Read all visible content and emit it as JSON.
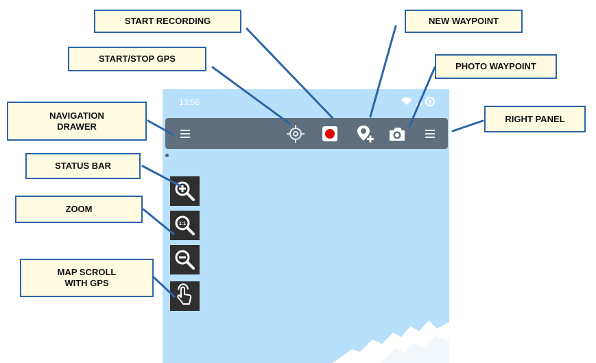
{
  "status_bar": {
    "time": "13:56"
  },
  "callouts": {
    "start_recording": "START RECORDING",
    "new_waypoint": "NEW WAYPOINT",
    "start_stop_gps": "START/STOP GPS",
    "photo_waypoint": "PHOTO WAYPOINT",
    "navigation_drawer": "NAVIGATION\nDRAWER",
    "right_panel": "RIGHT PANEL",
    "status_bar": "STATUS BAR",
    "zoom": "ZOOM",
    "map_scroll_with_gps": "MAP SCROLL\nWITH GPS"
  },
  "toolbar_icons": [
    "menu-icon",
    "gps-target-icon",
    "record-icon",
    "add-waypoint-icon",
    "camera-icon",
    "menu-icon"
  ],
  "map_controls": [
    "zoom-in-icon",
    "zoom-reset-icon",
    "zoom-out-icon",
    "gps-scroll-hand-icon"
  ],
  "colors": {
    "map_background": "#b9e0fb",
    "toolbar": "#5f6f7d",
    "record_dot": "#e00000",
    "callout_fill": "#fffbe0",
    "callout_border": "#2d64a8",
    "control_background": "#2f2f2f"
  }
}
